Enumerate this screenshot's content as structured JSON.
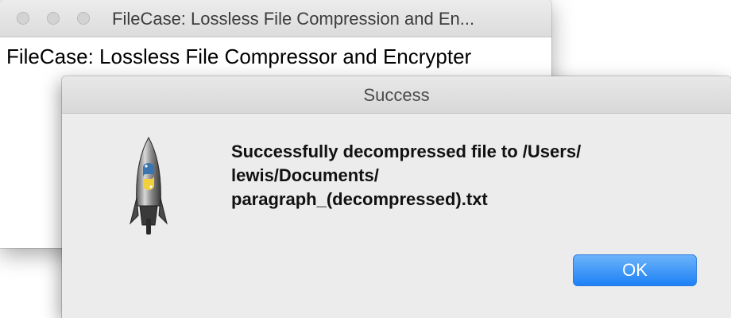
{
  "main_window": {
    "title": "FileCase: Lossless File Compression and En...",
    "heading": "FileCase: Lossless File Compressor and Encrypter"
  },
  "dialog": {
    "title": "Success",
    "message_lines": [
      "Successfully decompressed file to /Users/",
      "lewis/Documents/",
      "paragraph_(decompressed).txt"
    ],
    "ok_label": "OK",
    "icon": "python-launcher-rocket-icon"
  },
  "colors": {
    "accent_button": "#1d81f5"
  }
}
